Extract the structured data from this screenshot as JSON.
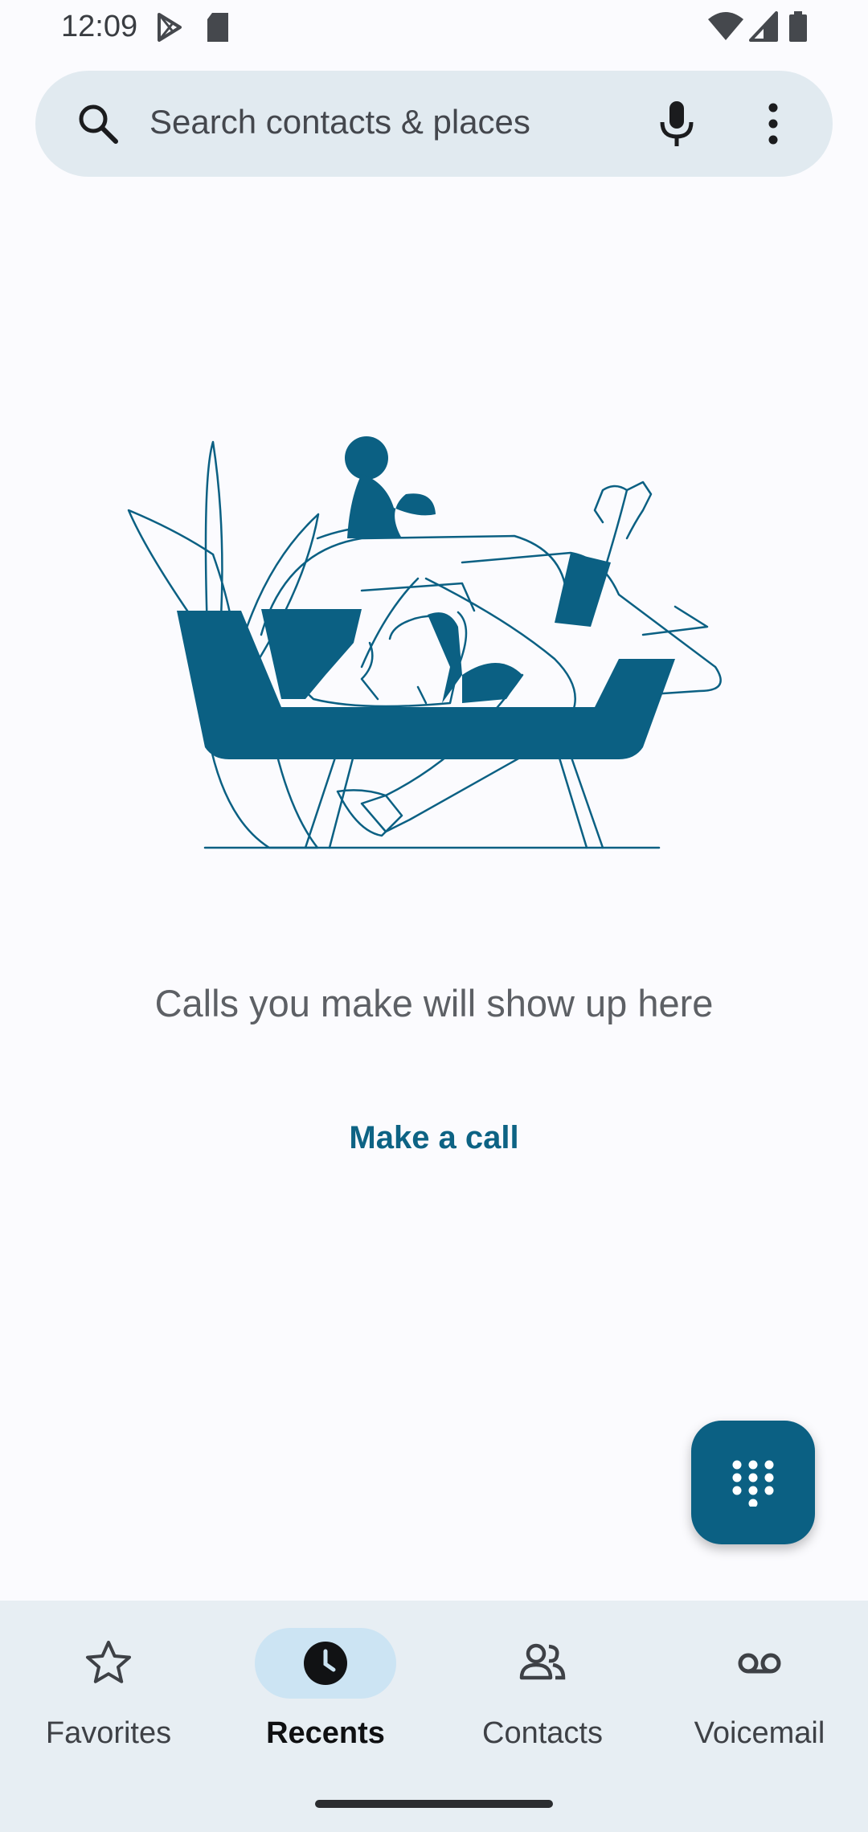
{
  "status_bar": {
    "time": "12:09",
    "left_icons": [
      "play-store-icon",
      "sd-card-icon"
    ],
    "right_icons": [
      "wifi-icon",
      "signal-icon",
      "battery-icon"
    ]
  },
  "search": {
    "placeholder": "Search contacts & places",
    "icons": [
      "search-icon",
      "mic-icon",
      "more-vert-icon"
    ]
  },
  "empty_state": {
    "message": "Calls you make will show up here",
    "action_label": "Make a call",
    "illustration": "person-on-sofa-with-dog-illustration"
  },
  "fab": {
    "icon": "dialpad-icon"
  },
  "bottom_nav": {
    "items": [
      {
        "label": "Favorites",
        "icon": "star-outline-icon",
        "active": false
      },
      {
        "label": "Recents",
        "icon": "clock-icon",
        "active": true
      },
      {
        "label": "Contacts",
        "icon": "people-icon",
        "active": false
      },
      {
        "label": "Voicemail",
        "icon": "voicemail-icon",
        "active": false
      }
    ]
  },
  "colors": {
    "accent": "#0b6083",
    "search_bg": "#e1eaf0",
    "nav_bg": "#e7eef3",
    "active_pill": "#cce4f3",
    "background": "#fbfbfe"
  }
}
